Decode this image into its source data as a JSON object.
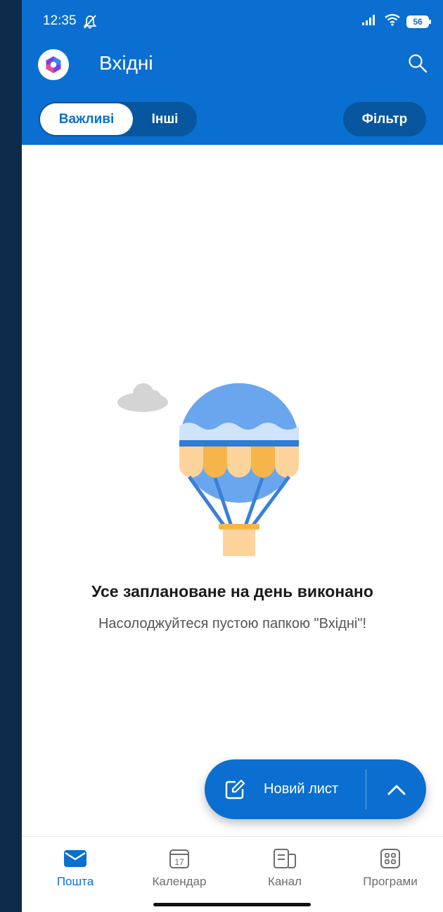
{
  "status_bar": {
    "time": "12:35",
    "battery": "56",
    "icons": [
      "mute-icon",
      "signal-icon",
      "wifi-icon",
      "battery-icon"
    ]
  },
  "header": {
    "title": "Вхідні",
    "tabs": [
      {
        "label": "Важливі",
        "active": true
      },
      {
        "label": "Інші",
        "active": false
      }
    ],
    "filter_label": "Фільтр"
  },
  "empty_state": {
    "title": "Усе заплановане на день виконано",
    "subtitle": "Насолоджуйтеся пустою папкою \"Вхідні\"!"
  },
  "fab": {
    "label": "Новий лист"
  },
  "bottom_nav": [
    {
      "label": "Пошта",
      "icon": "mail-icon",
      "active": true
    },
    {
      "label": "Календар",
      "icon": "calendar-icon",
      "active": false,
      "day": "17"
    },
    {
      "label": "Канал",
      "icon": "feed-icon",
      "active": false
    },
    {
      "label": "Програми",
      "icon": "apps-icon",
      "active": false
    }
  ],
  "colors": {
    "accent": "#0a6fd0",
    "header_pill": "#08569f",
    "background_side": "#0f2b4c"
  }
}
